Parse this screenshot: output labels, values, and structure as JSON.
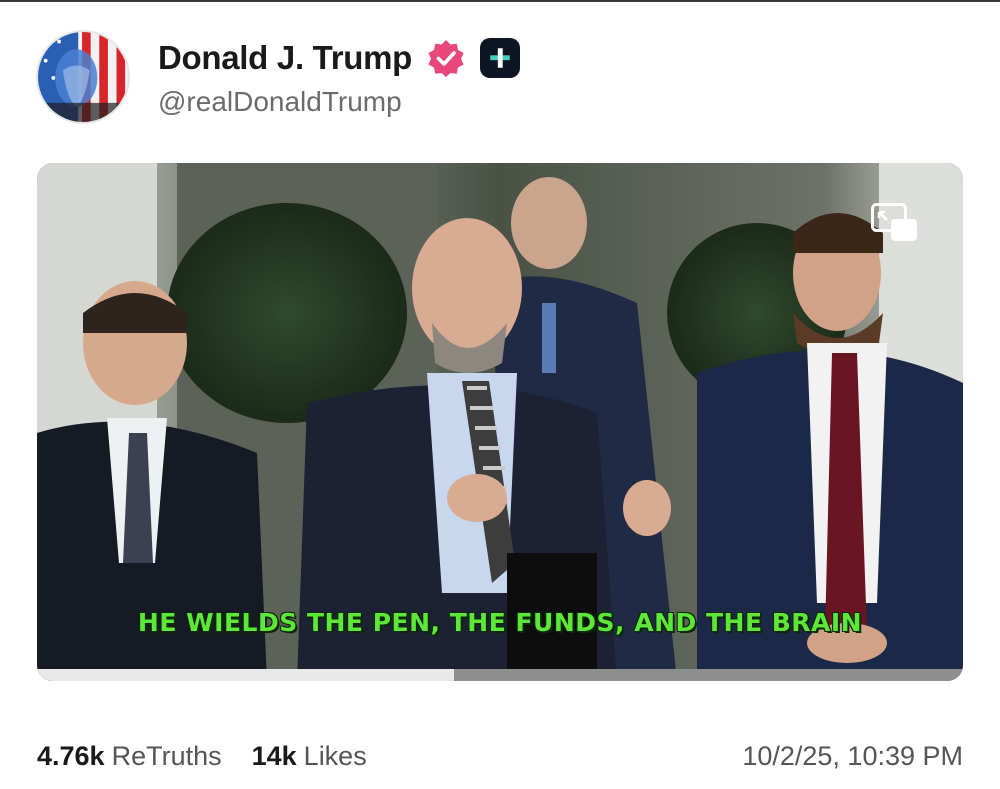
{
  "post": {
    "author": {
      "display_name": "Donald J. Trump",
      "handle": "@realDonaldTrump",
      "avatar_icon": "flag-portrait-avatar",
      "verified_icon": "verified-badge-icon",
      "badge_icon": "truth-plus-icon"
    },
    "media": {
      "type": "video",
      "caption": "HE WIELDS THE PEN, THE FUNDS, AND THE BRAIN",
      "pip_icon": "picture-in-picture-icon",
      "progress": 0.45
    },
    "stats": {
      "retruths_count": "4.76k",
      "retruths_label": "ReTruths",
      "likes_count": "14k",
      "likes_label": "Likes"
    },
    "timestamp": "10/2/25, 10:39 PM"
  },
  "colors": {
    "verified": "#e8477a",
    "caption": "#5fe63a",
    "badge_bg": "#0d1424"
  }
}
